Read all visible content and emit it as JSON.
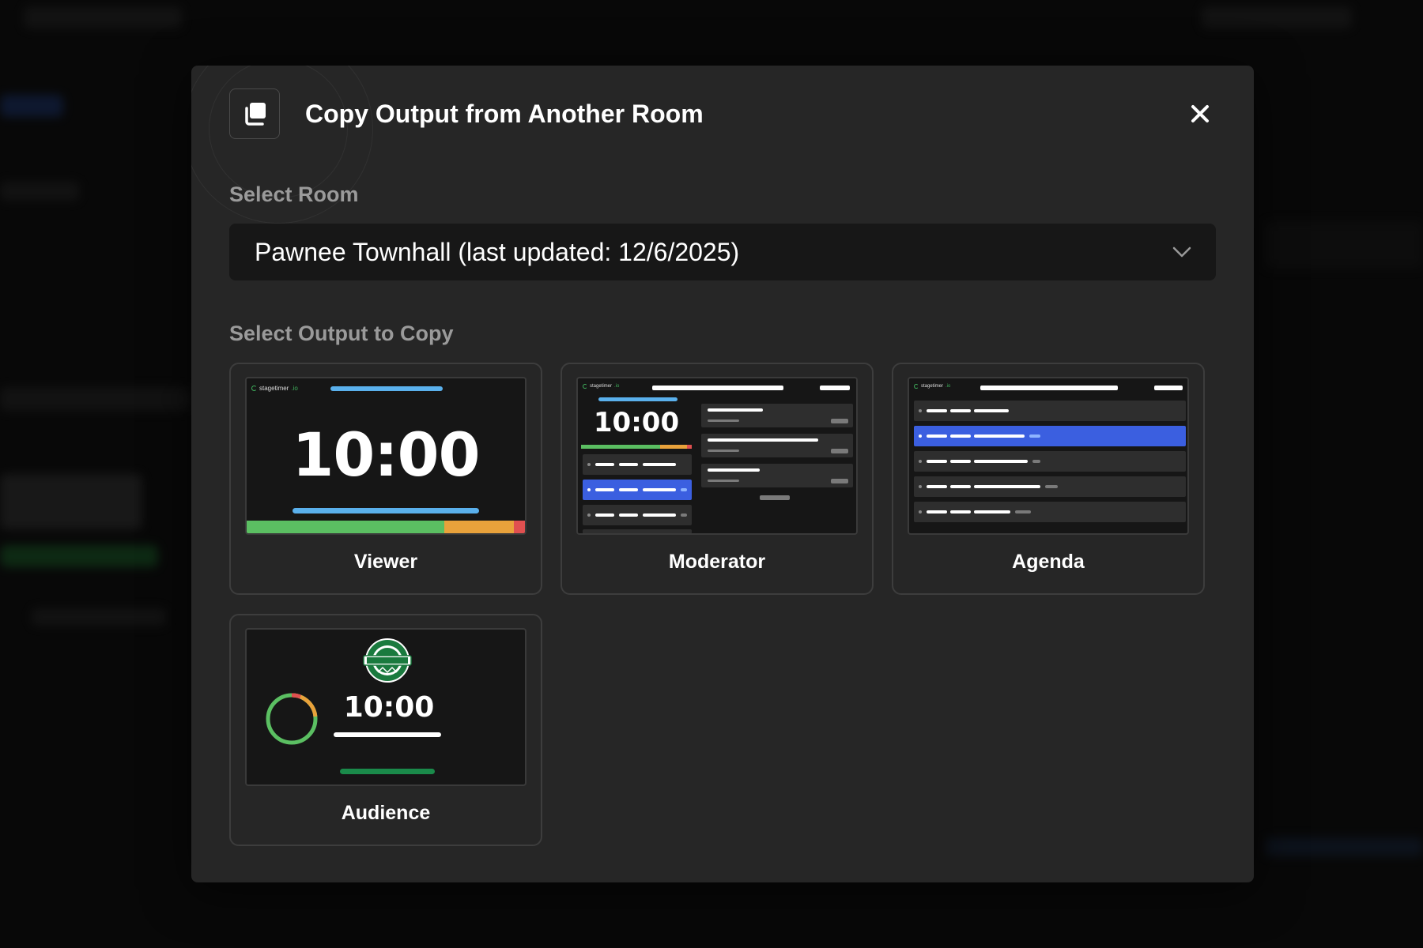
{
  "modal": {
    "title": "Copy Output from Another Room",
    "close_label": "×"
  },
  "room_select": {
    "label": "Select Room",
    "value": "Pawnee Townhall (last updated: 12/6/2025)"
  },
  "outputs": {
    "label": "Select Output to Copy",
    "brand_name": "stagetimer",
    "brand_suffix": ".io",
    "items": [
      {
        "label": "Viewer",
        "timer": "10:00"
      },
      {
        "label": "Moderator",
        "timer": "10:00"
      },
      {
        "label": "Agenda"
      },
      {
        "label": "Audience",
        "timer": "10:00"
      }
    ]
  },
  "colors": {
    "modal_bg": "#262626",
    "select_bg": "#171717",
    "accent_blue": "#3b5fe0",
    "light_blue": "#5ab0ec",
    "green": "#5bbf62",
    "orange": "#e9a23b",
    "red": "#e05050",
    "dark_green": "#1a8a4a"
  }
}
